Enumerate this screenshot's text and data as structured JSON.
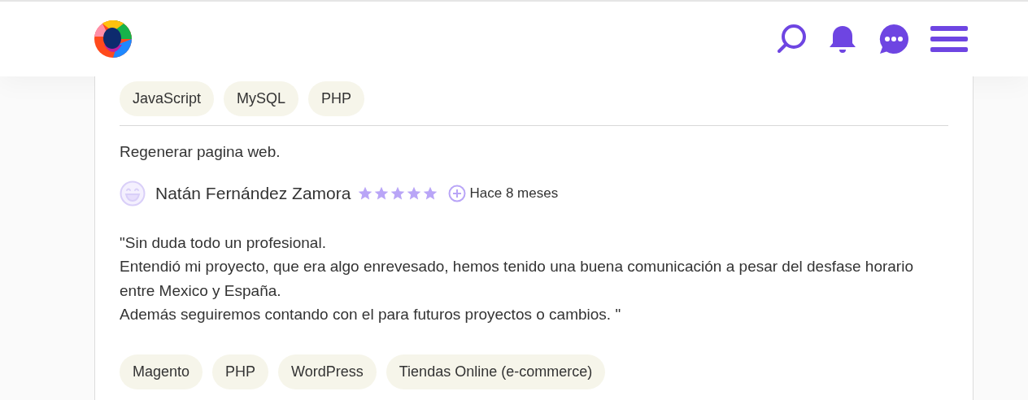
{
  "top_tags": [
    "JavaScript",
    "MySQL",
    "PHP"
  ],
  "review": {
    "title": "Regenerar pagina web.",
    "reviewer": "Natán Fernández Zamora",
    "stars": 5,
    "time": "Hace 8 meses",
    "quote": [
      "\"Sin duda todo un profesional.",
      "Entendió mi proyecto, que era algo enrevesado, hemos tenido una buena comunicación a pesar del desfase horario entre Mexico y España.",
      "Además seguiremos contando con el para futuros proyectos o cambios. \""
    ],
    "tags": [
      "Magento",
      "PHP",
      "WordPress",
      "Tiendas Online (e-commerce)"
    ]
  }
}
